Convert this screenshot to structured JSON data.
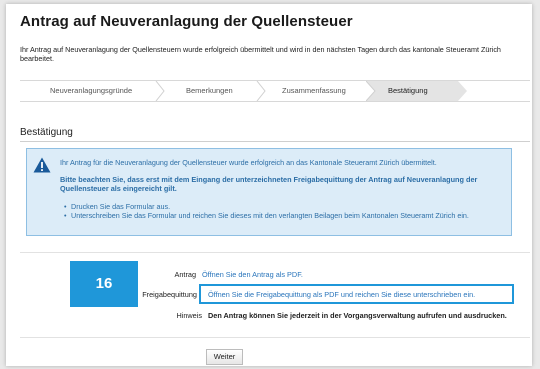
{
  "page": {
    "title": "Antrag auf Neuveranlagung der Quellensteuer",
    "intro": "Ihr Antrag auf Neuveranlagung der Quellensteuern wurde erfolgreich übermittelt und wird in den nächsten Tagen durch das kantonale Steueramt Zürich bearbeitet."
  },
  "steps": [
    {
      "label": "Neuveranlagungsgründe"
    },
    {
      "label": "Bemerkungen"
    },
    {
      "label": "Zusammenfassung"
    },
    {
      "label": "Bestätigung"
    }
  ],
  "section": {
    "title": "Bestätigung"
  },
  "info": {
    "main": "Ihr Antrag für die Neuveranlagung der Quellensteuer wurde erfolgreich an das Kantonale Steueramt Zürich übermittelt.",
    "bold": "Bitte beachten Sie, dass erst mit dem Eingang der unterzeichneten Freigabequittung der Antrag auf Neuveranlagung der Quellensteuer als eingereicht gilt.",
    "list": [
      "Drucken Sie das Formular aus.",
      "Unterschreiben Sie das Formular und reichen Sie dieses mit den verlangten Beilagen beim Kantonalen Steueramt Zürich ein."
    ],
    "icon": "warning-icon"
  },
  "badge": {
    "number": "16"
  },
  "rows": {
    "antrag_label": "Antrag",
    "antrag_link": "Öffnen Sie den Antrag als PDF.",
    "freigabe_label": "Freigabequittung",
    "freigabe_link": "Öffnen Sie die Freigabequittung als PDF und reichen Sie diese unterschrieben ein.",
    "hinweis_label": "Hinweis",
    "hinweis_text": "Den Antrag können Sie jederzeit in der Vorgangsverwaltung aufrufen und ausdrucken."
  },
  "actions": {
    "next_label": "Weiter"
  },
  "colors": {
    "accent": "#1f97d9",
    "info_bg": "#dcecf8",
    "info_text": "#2c6ea6",
    "link": "#2a75bb"
  }
}
